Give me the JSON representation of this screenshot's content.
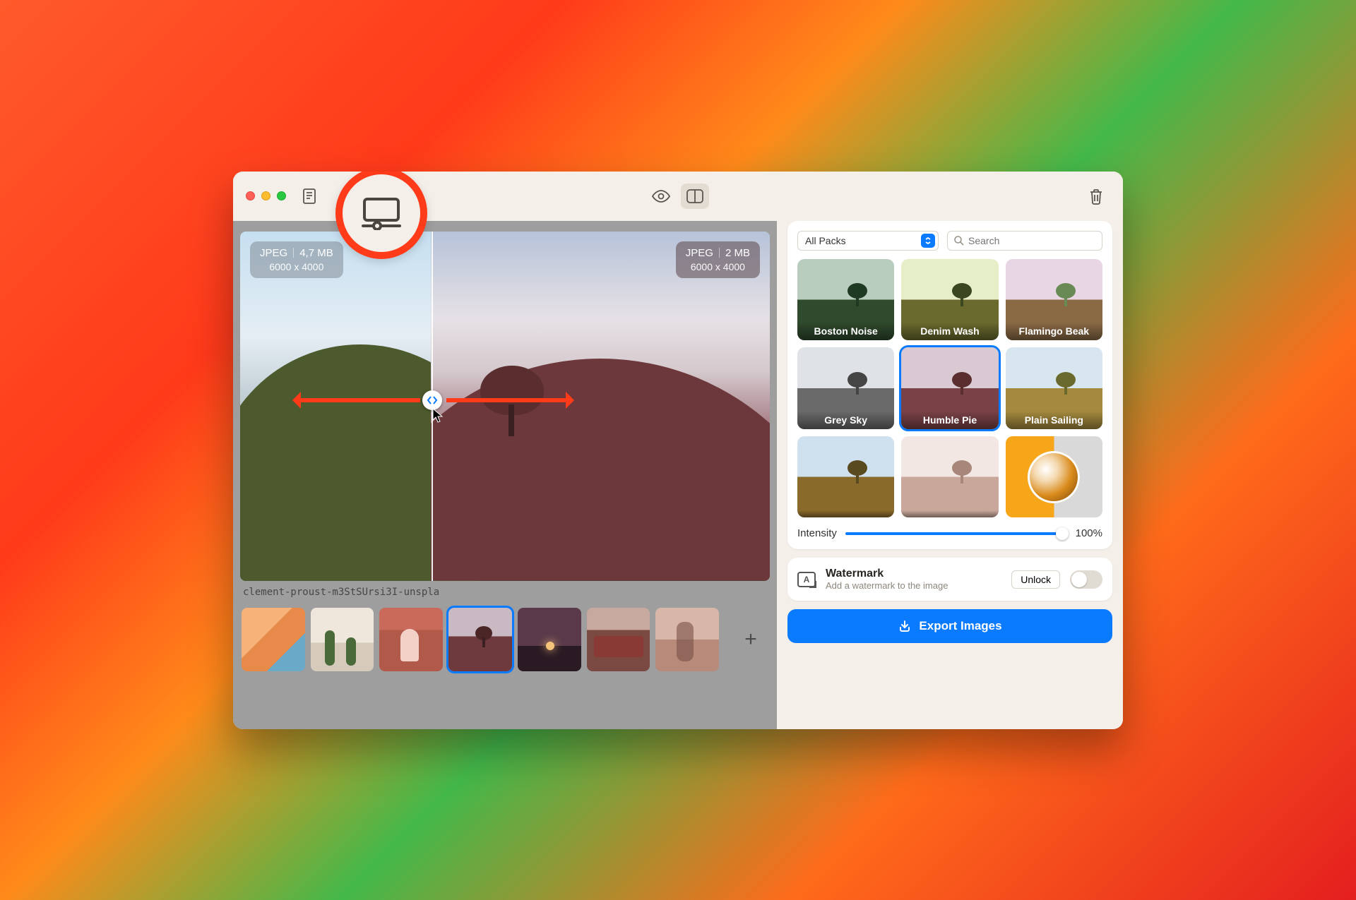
{
  "toolbar": {},
  "preview": {
    "original": {
      "format": "JPEG",
      "size": "4,7 MB",
      "dimensions": "6000 x 4000"
    },
    "filtered": {
      "format": "JPEG",
      "size": "2 MB",
      "dimensions": "6000 x 4000"
    },
    "filename": "clement-proust-m3StSUrsi3I-unspla"
  },
  "thumbnails": {
    "add_label": "+",
    "selected_index": 3
  },
  "styles_panel": {
    "filter_dropdown": "All Packs",
    "search_placeholder": "Search",
    "styles": [
      {
        "name": "Boston Noise"
      },
      {
        "name": "Denim Wash"
      },
      {
        "name": "Flamingo Beak"
      },
      {
        "name": "Grey Sky"
      },
      {
        "name": "Humble Pie"
      },
      {
        "name": "Plain Sailing"
      },
      {
        "name": ""
      },
      {
        "name": ""
      },
      {
        "name": ""
      }
    ],
    "selected_style_index": 4,
    "intensity_label": "Intensity",
    "intensity_value": "100%"
  },
  "watermark": {
    "title": "Watermark",
    "subtitle": "Add a watermark to the image",
    "unlock_label": "Unlock"
  },
  "export": {
    "label": "Export Images"
  },
  "style_colors": {
    "boston": {
      "sky": "#b9cdbf",
      "hill": "#2f4a2d",
      "crown": "#1f3a22"
    },
    "denim": {
      "sky": "#e6eec8",
      "hill": "#6a6a2e",
      "crown": "#3b481f"
    },
    "flamingo": {
      "sky": "#e9d6e5",
      "hill": "#8a6a45",
      "crown": "#6a8a55"
    },
    "grey": {
      "sky": "#dfe3e7",
      "hill": "#6a6a6a",
      "crown": "#454545"
    },
    "humble": {
      "sky": "#d9c9d3",
      "hill": "#7a4247",
      "crown": "#5a2e2e"
    },
    "plain": {
      "sky": "#d7e6ef",
      "hill": "#a58a3e",
      "crown": "#6a6a2e"
    },
    "s7": {
      "sky": "#cfe0ef",
      "hill": "#8a6a2a",
      "crown": "#5a4a1f"
    },
    "s8": {
      "sky": "#f2e7e2",
      "hill": "#c9a79a",
      "crown": "#a8867a"
    }
  }
}
